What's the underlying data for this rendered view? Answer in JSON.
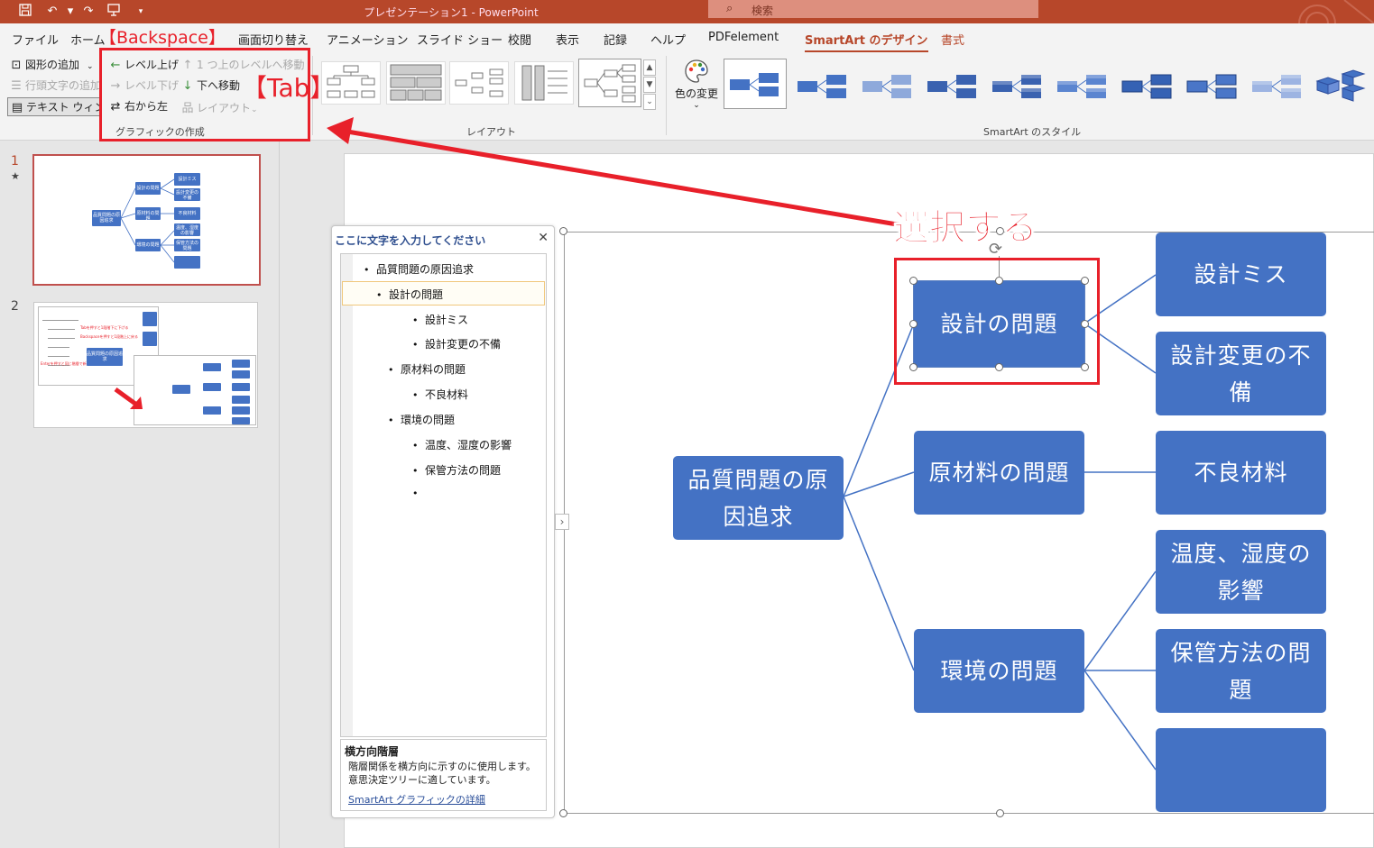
{
  "app": {
    "title": "プレゼンテーション1  -  PowerPoint",
    "search_placeholder": "検索",
    "accent_color": "#b7472a"
  },
  "quick_access": {
    "icons": [
      "save-icon",
      "undo-icon",
      "redo-icon",
      "presentation-icon",
      "customize-icon"
    ]
  },
  "tabs": [
    {
      "label": "ファイル"
    },
    {
      "label": "ホーム"
    },
    {
      "label": "画面切り替え"
    },
    {
      "label": "アニメーション"
    },
    {
      "label": "スライド ショー"
    },
    {
      "label": "校閲"
    },
    {
      "label": "表示"
    },
    {
      "label": "記録"
    },
    {
      "label": "ヘルプ"
    },
    {
      "label": "PDFelement"
    },
    {
      "label": "SmartArt のデザイン"
    },
    {
      "label": "書式"
    }
  ],
  "ribbon": {
    "create_graphic": {
      "add_shape": "図形の追加",
      "add_bullet": "行頭文字の追加",
      "text_pane": "テキスト ウィンドウ",
      "promote": "レベル上げ",
      "demote": "レベル下げ",
      "right_to_left": "右から左",
      "move_up": "1 つ上のレベルへ移動",
      "move_down": "下へ移動",
      "layout": "レイアウト",
      "group_label": "グラフィックの作成"
    },
    "layouts": {
      "group_label": "レイアウト"
    },
    "styles": {
      "change_colors": "色の変更",
      "group_label": "SmartArt のスタイル"
    }
  },
  "slides": {
    "items": [
      {
        "number": "1",
        "star": "★"
      },
      {
        "number": "2"
      }
    ],
    "thumb1": {
      "root": "品質問題の原因追求",
      "level1": [
        "設計の問題",
        "原材料の問題",
        "環境の問題"
      ],
      "level2": [
        "設計ミス",
        "設計変更の不備",
        "不良材料",
        "温度、湿度の影響",
        "保管方法の問題",
        ""
      ]
    },
    "thumb2": {
      "root": "品質問題の原因追求",
      "note1": "Tabを押すと1段階下に下げる",
      "note2": "Backspaceを押すと1段階上に戻る",
      "note3": "Enterを押すと同じ階層で新規入力"
    }
  },
  "text_pane": {
    "title": "ここに文字を入力してください",
    "items": [
      {
        "text": "品質問題の原因追求"
      },
      {
        "text": "設計の問題"
      },
      {
        "text": "設計ミス"
      },
      {
        "text": "設計変更の不備"
      },
      {
        "text": "原材料の問題"
      },
      {
        "text": "不良材料"
      },
      {
        "text": "環境の問題"
      },
      {
        "text": "温度、湿度の影響"
      },
      {
        "text": "保管方法の問題"
      },
      {
        "text": ""
      }
    ],
    "layout_name": "横方向階層",
    "layout_desc": "階層関係を横方向に示すのに使用します。意思決定ツリーに適しています。",
    "details_link": "SmartArt グラフィックの詳細"
  },
  "smartart": {
    "root": "品質問題の原因追求",
    "level1": [
      "設計の問題",
      "原材料の問題",
      "環境の問題"
    ],
    "level2": [
      "設計ミス",
      "設計変更の不備",
      "不良材料",
      "温度、湿度の影響",
      "保管方法の問題",
      ""
    ],
    "node_color": "#4472c4"
  },
  "annotations": {
    "select": "選択する",
    "backspace": "【Backspace】",
    "tab": "【Tab】",
    "color": "#e8202a"
  }
}
